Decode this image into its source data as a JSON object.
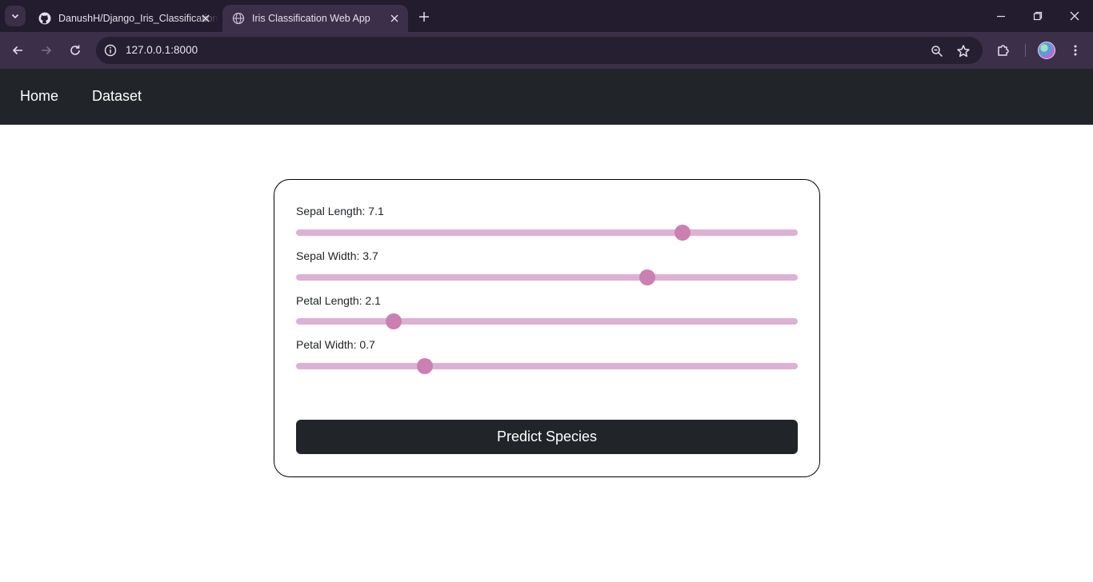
{
  "browser": {
    "tabs": [
      {
        "title": "DanushH/Django_Iris_Classification",
        "favicon": "github-icon",
        "active": false
      },
      {
        "title": "Iris Classification Web App",
        "favicon": "globe-icon",
        "active": true
      }
    ],
    "url": "127.0.0.1:8000"
  },
  "nav": {
    "links": [
      {
        "label": "Home"
      },
      {
        "label": "Dataset"
      }
    ]
  },
  "form": {
    "fields": [
      {
        "name": "Sepal Length",
        "value": "7.1",
        "label": "Sepal Length: 7.1",
        "level": 0.77
      },
      {
        "name": "Sepal Width",
        "value": "3.7",
        "label": "Sepal Width: 3.7",
        "level": 0.7
      },
      {
        "name": "Petal Length",
        "value": "2.1",
        "label": "Petal Length: 2.1",
        "level": 0.195
      },
      {
        "name": "Petal Width",
        "value": "0.7",
        "label": "Petal Width: 0.7",
        "level": 0.257
      }
    ],
    "submit_label": "Predict Species"
  },
  "colors": {
    "nav_bg": "#212529",
    "slider_track": "#dcb1d3",
    "slider_thumb": "#cc7fb1",
    "button_bg": "#212529"
  }
}
